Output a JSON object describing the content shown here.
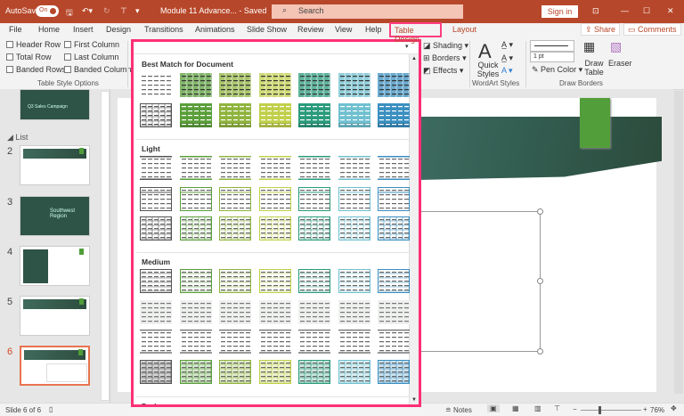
{
  "titlebar": {
    "autosave": "AutoSave",
    "toggle": "On",
    "doc": "Module 11 Advance... - Saved",
    "search": "Search",
    "signin": "Sign in",
    "colors": {
      "bar": "#b7472a",
      "accent": "#ff2f76"
    }
  },
  "tabs": [
    "File",
    "Home",
    "Insert",
    "Design",
    "Transitions",
    "Animations",
    "Slide Show",
    "Review",
    "View",
    "Help",
    "Table Design",
    "Layout"
  ],
  "share": "Share",
  "comments": "Comments",
  "ribbon": {
    "options": [
      {
        "label": "Header Row",
        "checked": false
      },
      {
        "label": "Total Row",
        "checked": false
      },
      {
        "label": "Banded Rows",
        "checked": false
      },
      {
        "label": "First Column",
        "checked": false
      },
      {
        "label": "Last Column",
        "checked": false
      },
      {
        "label": "Banded Columns",
        "checked": false
      }
    ],
    "options_group": "Table Style Options",
    "shading": "Shading",
    "borders": "Borders",
    "effects": "Effects",
    "quick_styles": "Quick Styles",
    "wordart_group": "WordArt Styles",
    "pen_weight": "1 pt",
    "pen_color": "Pen Color",
    "draw_table": "Draw Table",
    "eraser": "Eraser",
    "draw_group": "Draw Borders"
  },
  "gallery": {
    "sections": [
      "Best Match for Document",
      "Light",
      "Medium",
      "Dark"
    ],
    "palette": [
      "#555555",
      "#5a9e3a",
      "#8fb43e",
      "#c0d04a",
      "#2b9b7c",
      "#6fc0d0",
      "#3a8fc0"
    ],
    "rows": [
      {
        "section": 0,
        "style": "plain-first"
      },
      {
        "section": 0,
        "style": "solid"
      },
      {
        "section": 1,
        "style": "lines"
      },
      {
        "section": 1,
        "style": "box"
      },
      {
        "section": 1,
        "style": "grid-light"
      },
      {
        "section": 2,
        "style": "grid-medium"
      },
      {
        "section": 2,
        "style": "banded-gray"
      },
      {
        "section": 2,
        "style": "rules"
      },
      {
        "section": 2,
        "style": "grid-strong"
      }
    ]
  },
  "pane": {
    "section": "List",
    "slides": [
      {
        "num": "2"
      },
      {
        "num": "3"
      },
      {
        "num": "4"
      },
      {
        "num": "5"
      },
      {
        "num": "6",
        "selected": true
      }
    ],
    "slide1_title": "Q3 Sales Campaign",
    "slide3_title": "Southwest Region"
  },
  "status": {
    "slide": "Slide 6 of 6",
    "notes": "Notes",
    "zoom": "76%"
  }
}
